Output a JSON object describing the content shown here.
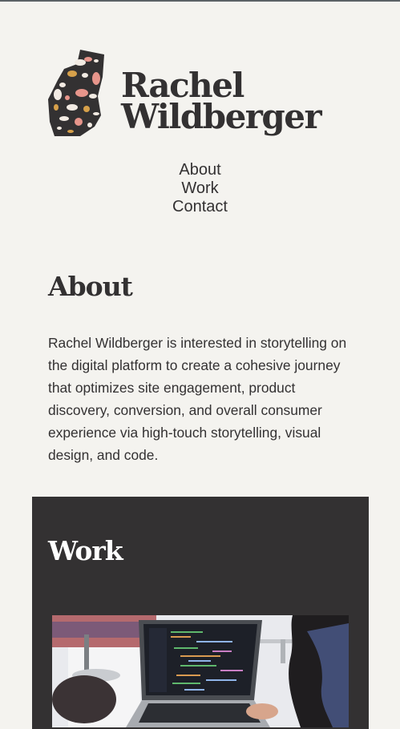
{
  "brand": {
    "first_name": "Rachel",
    "last_name": "Wildberger",
    "logo_icon": "terrazzo-shape-icon"
  },
  "nav": {
    "items": [
      {
        "label": "About"
      },
      {
        "label": "Work"
      },
      {
        "label": "Contact"
      }
    ]
  },
  "about": {
    "title": "About",
    "body": "Rachel Wildberger is interested in storytelling on the digital platform to create a cohesive journey that optimizes site engagement, product discovery, conversion, and overall consumer experience via high-touch storytelling, visual design, and code."
  },
  "work": {
    "title": "Work",
    "image_icon": "laptop-code-photo"
  },
  "colors": {
    "background": "#f4f3ef",
    "text": "#333132",
    "dark_section": "#333132",
    "terrazzo_pink": "#e7958b",
    "terrazzo_gold": "#d6a04a",
    "terrazzo_white": "#f2ebe3"
  }
}
